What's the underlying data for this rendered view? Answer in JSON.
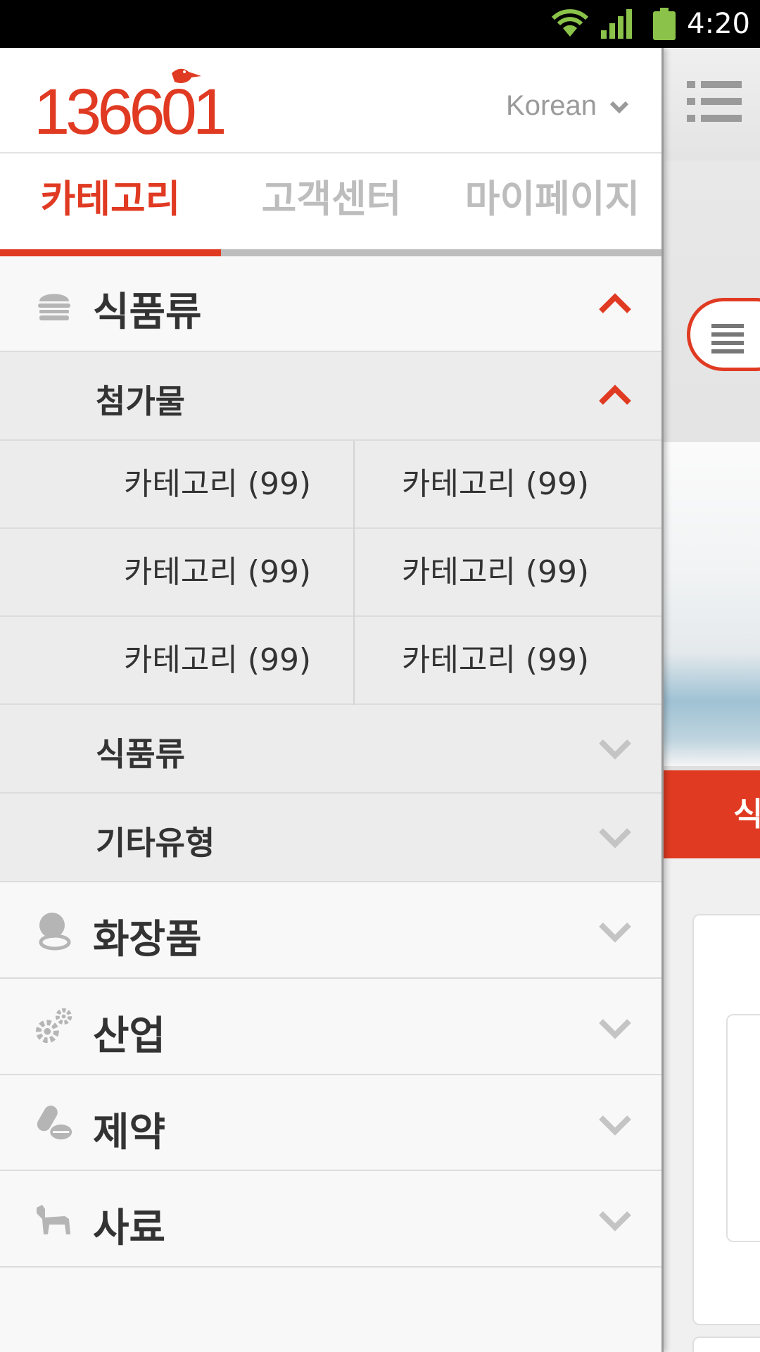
{
  "status_bar": {
    "time": "4:20"
  },
  "drawer": {
    "logo_text": "136601",
    "language": "Korean",
    "tabs": [
      {
        "label": "카테고리",
        "active": true
      },
      {
        "label": "고객센터",
        "active": false
      },
      {
        "label": "마이페이지",
        "active": false
      }
    ],
    "categories": [
      {
        "label": "식품류",
        "icon": "burger-icon",
        "expanded": true,
        "subcategories": [
          {
            "label": "첨가물",
            "expanded": true,
            "items": [
              "카테고리 (99)",
              "카테고리 (99)",
              "카테고리 (99)",
              "카테고리 (99)",
              "카테고리 (99)",
              "카테고리 (99)"
            ]
          },
          {
            "label": "식품류",
            "expanded": false
          },
          {
            "label": "기타유형",
            "expanded": false
          }
        ]
      },
      {
        "label": "화장품",
        "icon": "cosmetics-icon",
        "expanded": false
      },
      {
        "label": "산업",
        "icon": "gears-icon",
        "expanded": false
      },
      {
        "label": "제약",
        "icon": "pills-icon",
        "expanded": false
      },
      {
        "label": "사료",
        "icon": "dog-icon",
        "expanded": false
      }
    ]
  },
  "background_app": {
    "banner_text": "식"
  },
  "colors": {
    "accent": "#e03a22",
    "muted": "#bdbdbd",
    "text": "#333333"
  }
}
